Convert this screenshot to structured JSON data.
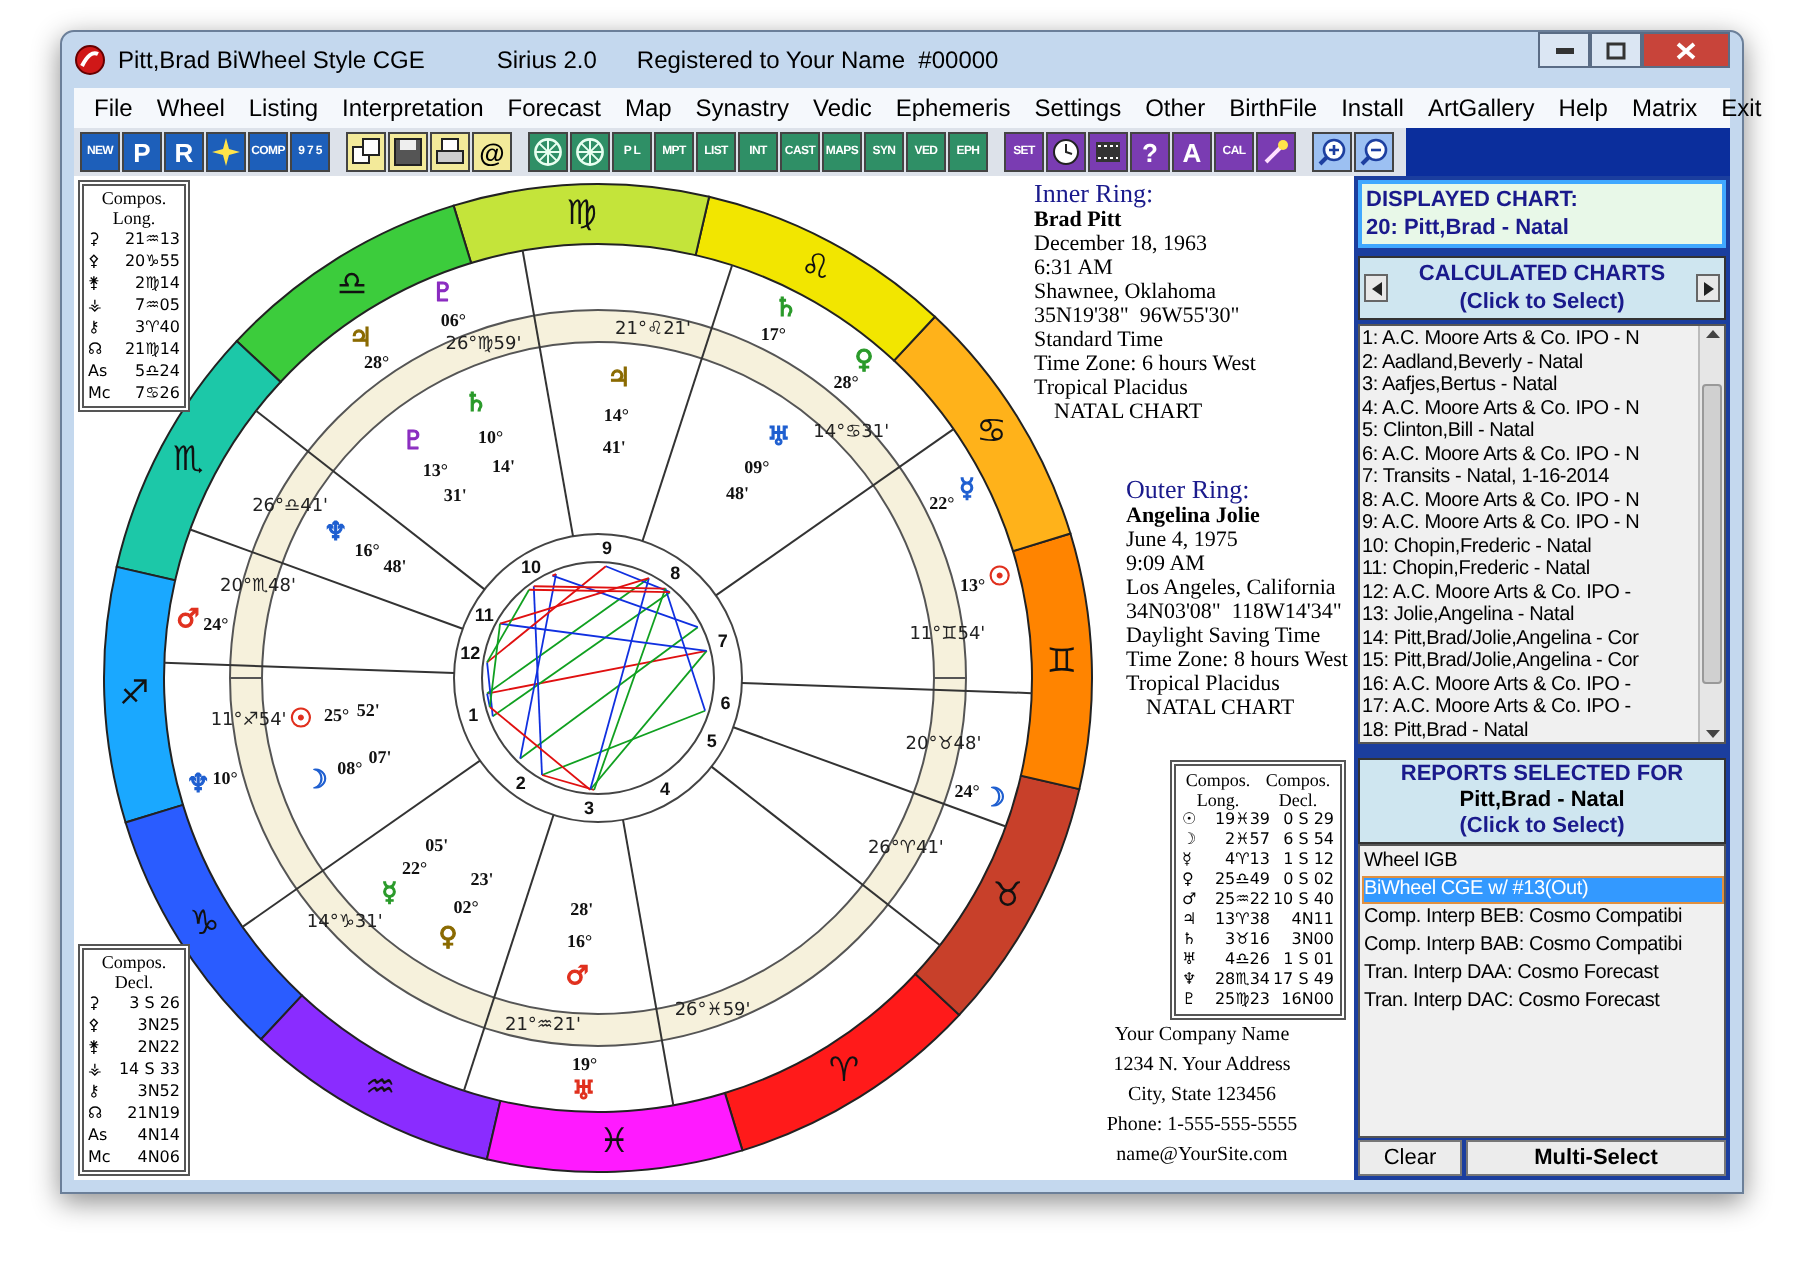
{
  "window": {
    "title": "Pitt,Brad BiWheel Style CGE",
    "app": "Sirius 2.0",
    "registration": "Registered to Your Name  #00000"
  },
  "menu": [
    "File",
    "Wheel",
    "Listing",
    "Interpretation",
    "Forecast",
    "Map",
    "Synastry",
    "Vedic",
    "Ephemeris",
    "Settings",
    "Other",
    "BirthFile",
    "Install",
    "ArtGallery",
    "Help",
    "Matrix",
    "Exit"
  ],
  "toolbar": [
    {
      "kind": "chart",
      "items": [
        {
          "kind": "text",
          "label": "NEW"
        },
        {
          "kind": "text",
          "label": "P"
        },
        {
          "kind": "text",
          "label": "R"
        },
        {
          "kind": "icon"
        },
        {
          "kind": "text",
          "label": "COMP"
        },
        {
          "kind": "text",
          "label": "9 7 5"
        }
      ]
    },
    {
      "kind": "file",
      "items": [
        {
          "kind": "icon"
        },
        {
          "kind": "icon"
        },
        {
          "kind": "icon"
        },
        {
          "kind": "text",
          "label": "@"
        }
      ]
    },
    {
      "kind": "wheel",
      "items": [
        {
          "kind": "icon"
        },
        {
          "kind": "icon"
        },
        {
          "kind": "text",
          "label": "P L"
        },
        {
          "kind": "text",
          "label": "MPT"
        },
        {
          "kind": "text",
          "label": "LIST"
        },
        {
          "kind": "text",
          "label": "INT"
        },
        {
          "kind": "text",
          "label": "CAST"
        },
        {
          "kind": "text",
          "label": "MAPS"
        },
        {
          "kind": "text",
          "label": "SYN"
        },
        {
          "kind": "text",
          "label": "VED"
        },
        {
          "kind": "text",
          "label": "EPH"
        }
      ]
    },
    {
      "kind": "tool",
      "items": [
        {
          "kind": "text",
          "label": "SET"
        },
        {
          "kind": "icon"
        },
        {
          "kind": "icon"
        },
        {
          "kind": "text",
          "label": "?"
        },
        {
          "kind": "text",
          "label": "A"
        },
        {
          "kind": "text",
          "label": "CAL"
        },
        {
          "kind": "icon"
        }
      ]
    },
    {
      "kind": "zoom",
      "items": [
        {
          "kind": "icon"
        },
        {
          "kind": "icon"
        }
      ]
    }
  ],
  "chart": {
    "compos_long_box": {
      "title": "Compos. Long.",
      "rows": [
        {
          "glyph": "⚳",
          "value": "21♒13"
        },
        {
          "glyph": "⚴",
          "value": "20♑55"
        },
        {
          "glyph": "⚵",
          "value": "2♍14"
        },
        {
          "glyph": "⚶",
          "value": "7♒05"
        },
        {
          "glyph": "⚷",
          "value": "3♈40"
        },
        {
          "glyph": "☊",
          "value": "21♍14"
        },
        {
          "glyph": "As",
          "value": "5♎24"
        },
        {
          "glyph": "Mc",
          "value": "7♋26"
        }
      ]
    },
    "compos_decl_box": {
      "title": "Compos. Decl.",
      "rows": [
        {
          "glyph": "⚳",
          "value": "3 S 26"
        },
        {
          "glyph": "⚴",
          "value": "3N25"
        },
        {
          "glyph": "⚵",
          "value": "2N22"
        },
        {
          "glyph": "⚶",
          "value": "14 S 33"
        },
        {
          "glyph": "⚷",
          "value": "3N52"
        },
        {
          "glyph": "☊",
          "value": "21N19"
        },
        {
          "glyph": "As",
          "value": "4N14"
        },
        {
          "glyph": "Mc",
          "value": "4N06"
        }
      ]
    },
    "zodiac": [
      {
        "glyph": "♈",
        "color": "#ff1a1a"
      },
      {
        "glyph": "♉",
        "color": "#c8402a"
      },
      {
        "glyph": "♊",
        "color": "#ff8400"
      },
      {
        "glyph": "♋",
        "color": "#ffb21a"
      },
      {
        "glyph": "♌",
        "color": "#f2e600"
      },
      {
        "glyph": "♍",
        "color": "#c4e43a"
      },
      {
        "glyph": "♎",
        "color": "#3ccc3c"
      },
      {
        "glyph": "♏",
        "color": "#1cc8a8"
      },
      {
        "glyph": "♐",
        "color": "#1aa8ff"
      },
      {
        "glyph": "♑",
        "color": "#2a5cff"
      },
      {
        "glyph": "♒",
        "color": "#8a2cff"
      },
      {
        "glyph": "♓",
        "color": "#ff1aff"
      }
    ],
    "house_numbers": [
      "1",
      "2",
      "3",
      "4",
      "5",
      "6",
      "7",
      "8",
      "9",
      "10",
      "11",
      "12"
    ],
    "cusps": [
      "26°♍59'",
      "21°♌21'",
      "14°♋31'",
      "26°♎41'",
      "20°♏48'",
      "11°♊54'",
      "11°♐54'",
      "20°♉48'",
      "26°♈41'",
      "14°♑31'",
      "26°♓59'",
      "21°♒21'"
    ],
    "inner_planets": [
      {
        "glyph": "☉",
        "degree": "25°",
        "minute": "52'",
        "color": "#e0301e"
      },
      {
        "glyph": "☽",
        "degree": "08°",
        "minute": "07'",
        "color": "#1f5fd0"
      },
      {
        "glyph": "☿",
        "degree": "22°",
        "minute": "05'",
        "color": "#2a9a2a"
      },
      {
        "glyph": "♀",
        "degree": "02°",
        "minute": "23'",
        "color": "#8a6a00"
      },
      {
        "glyph": "♂",
        "degree": "16°",
        "minute": "28'",
        "color": "#e0301e"
      },
      {
        "glyph": "♃",
        "degree": "14°",
        "minute": "41'",
        "color": "#8a6a00"
      },
      {
        "glyph": "♄",
        "degree": "10°",
        "minute": "14'",
        "color": "#2a9a2a"
      },
      {
        "glyph": "♅",
        "degree": "09°",
        "minute": "48'",
        "color": "#1f5fd0"
      },
      {
        "glyph": "♆",
        "degree": "16°",
        "minute": "48'",
        "color": "#1f5fd0"
      },
      {
        "glyph": "♇",
        "degree": "13°",
        "minute": "31'",
        "color": "#8a2cc0"
      }
    ],
    "outer_planets": [
      {
        "glyph": "☉",
        "degree": "13°",
        "color": "#e0301e"
      },
      {
        "glyph": "☽",
        "degree": "24°",
        "color": "#1f5fd0"
      },
      {
        "glyph": "☿",
        "degree": "22°",
        "color": "#1f5fd0"
      },
      {
        "glyph": "♀",
        "degree": "28°",
        "color": "#2a9a2a"
      },
      {
        "glyph": "♄",
        "degree": "17°",
        "color": "#2a9a2a"
      },
      {
        "glyph": "♃",
        "degree": "28°",
        "color": "#8a6a00"
      },
      {
        "glyph": "♇",
        "degree": "06°",
        "color": "#8a2cc0"
      },
      {
        "glyph": "♂",
        "degree": "24°",
        "color": "#e0301e"
      },
      {
        "glyph": "♆",
        "degree": "10°",
        "color": "#1f5fd0"
      },
      {
        "glyph": "♅",
        "degree": "19°",
        "color": "#e0301e"
      }
    ],
    "inner_ring": {
      "heading": "Inner Ring:",
      "name": "Brad Pitt",
      "lines": [
        "December 18, 1963",
        "6:31 AM",
        "Shawnee, Oklahoma",
        "35N19'38\"  96W55'30\"",
        "Standard Time",
        "Time Zone: 6 hours West",
        "Tropical Placidus",
        "NATAL CHART"
      ]
    },
    "outer_ring": {
      "heading": "Outer Ring:",
      "name": "Angelina Jolie",
      "lines": [
        "June 4, 1975",
        "9:09 AM",
        "Los Angeles, California",
        "34N03'08\"  118W14'34\"",
        "Daylight Saving Time",
        "Time Zone: 8 hours West",
        "Tropical Placidus",
        "NATAL CHART"
      ]
    },
    "compos_table": {
      "headers": [
        "Compos. Long.",
        "Compos. Decl."
      ],
      "rows": [
        {
          "glyph": "☉",
          "long": "19♓39",
          "decl": "0 S 29"
        },
        {
          "glyph": "☽",
          "long": "2♓57",
          "decl": "6 S 54"
        },
        {
          "glyph": "☿",
          "long": "4♈13",
          "decl": "1 S 12"
        },
        {
          "glyph": "♀",
          "long": "25♎49",
          "decl": "0 S 02"
        },
        {
          "glyph": "♂",
          "long": "25♒22",
          "decl": "10 S 40"
        },
        {
          "glyph": "♃",
          "long": "13♈38",
          "decl": "4N11"
        },
        {
          "glyph": "♄",
          "long": "3♉16",
          "decl": "3N00"
        },
        {
          "glyph": "♅",
          "long": "4♎26",
          "decl": "1 S 01"
        },
        {
          "glyph": "♆",
          "long": "28♏34",
          "decl": "17 S 49"
        },
        {
          "glyph": "♇",
          "long": "25♍23",
          "decl": "16N00"
        }
      ]
    },
    "company": [
      "Your Company Name",
      "1234 N. Your Address",
      "City, State 123456",
      "Phone: 1-555-555-5555",
      "name@YourSite.com"
    ]
  },
  "sidebar": {
    "displayed_chart": {
      "heading": "DISPLAYED CHART:",
      "value": "20: Pitt,Brad - Natal"
    },
    "calculated_header": {
      "title": "CALCULATED CHARTS",
      "hint": "(Click to Select)"
    },
    "calculated_charts": [
      {
        "label": "1: A.C. Moore Arts & Co. IPO - N",
        "selected": false
      },
      {
        "label": "2: Aadland,Beverly - Natal",
        "selected": false
      },
      {
        "label": "3: Aafjes,Bertus - Natal",
        "selected": false
      },
      {
        "label": "4: A.C. Moore Arts & Co. IPO - N",
        "selected": false
      },
      {
        "label": "5: Clinton,Bill - Natal",
        "selected": false
      },
      {
        "label": "6: A.C. Moore Arts & Co. IPO - N",
        "selected": false
      },
      {
        "label": "7: Transits - Natal, 1-16-2014",
        "selected": false
      },
      {
        "label": "8: A.C. Moore Arts & Co. IPO - N",
        "selected": false
      },
      {
        "label": "9: A.C. Moore Arts & Co. IPO - N",
        "selected": false
      },
      {
        "label": "10: Chopin,Frederic - Natal",
        "selected": false
      },
      {
        "label": "11: Chopin,Frederic - Natal",
        "selected": false
      },
      {
        "label": "12: A.C. Moore Arts & Co. IPO -",
        "selected": false
      },
      {
        "label": "13: Jolie,Angelina - Natal",
        "selected": false
      },
      {
        "label": "14: Pitt,Brad/Jolie,Angelina - Cor",
        "selected": false
      },
      {
        "label": "15: Pitt,Brad/Jolie,Angelina - Cor",
        "selected": false
      },
      {
        "label": "16: A.C. Moore Arts & Co. IPO -",
        "selected": false
      },
      {
        "label": "17: A.C. Moore Arts & Co. IPO -",
        "selected": false
      },
      {
        "label": "18: Pitt,Brad - Natal",
        "selected": false
      }
    ],
    "reports_header": {
      "title": "REPORTS SELECTED FOR",
      "subject": "Pitt,Brad - Natal",
      "hint": "(Click to Select)"
    },
    "reports": [
      {
        "label": "Wheel IGB",
        "selected": false
      },
      {
        "label": "BiWheel CGE w/ #13(Out)",
        "selected": true
      },
      {
        "label": "Comp. Interp BEB: Cosmo Compatibi",
        "selected": false
      },
      {
        "label": "Comp. Interp BAB: Cosmo Compatibi",
        "selected": false
      },
      {
        "label": "Tran. Interp DAA: Cosmo Forecast",
        "selected": false
      },
      {
        "label": "Tran. Interp DAC: Cosmo Forecast",
        "selected": false
      }
    ],
    "buttons": [
      "Clear",
      "Multi-Select"
    ]
  }
}
